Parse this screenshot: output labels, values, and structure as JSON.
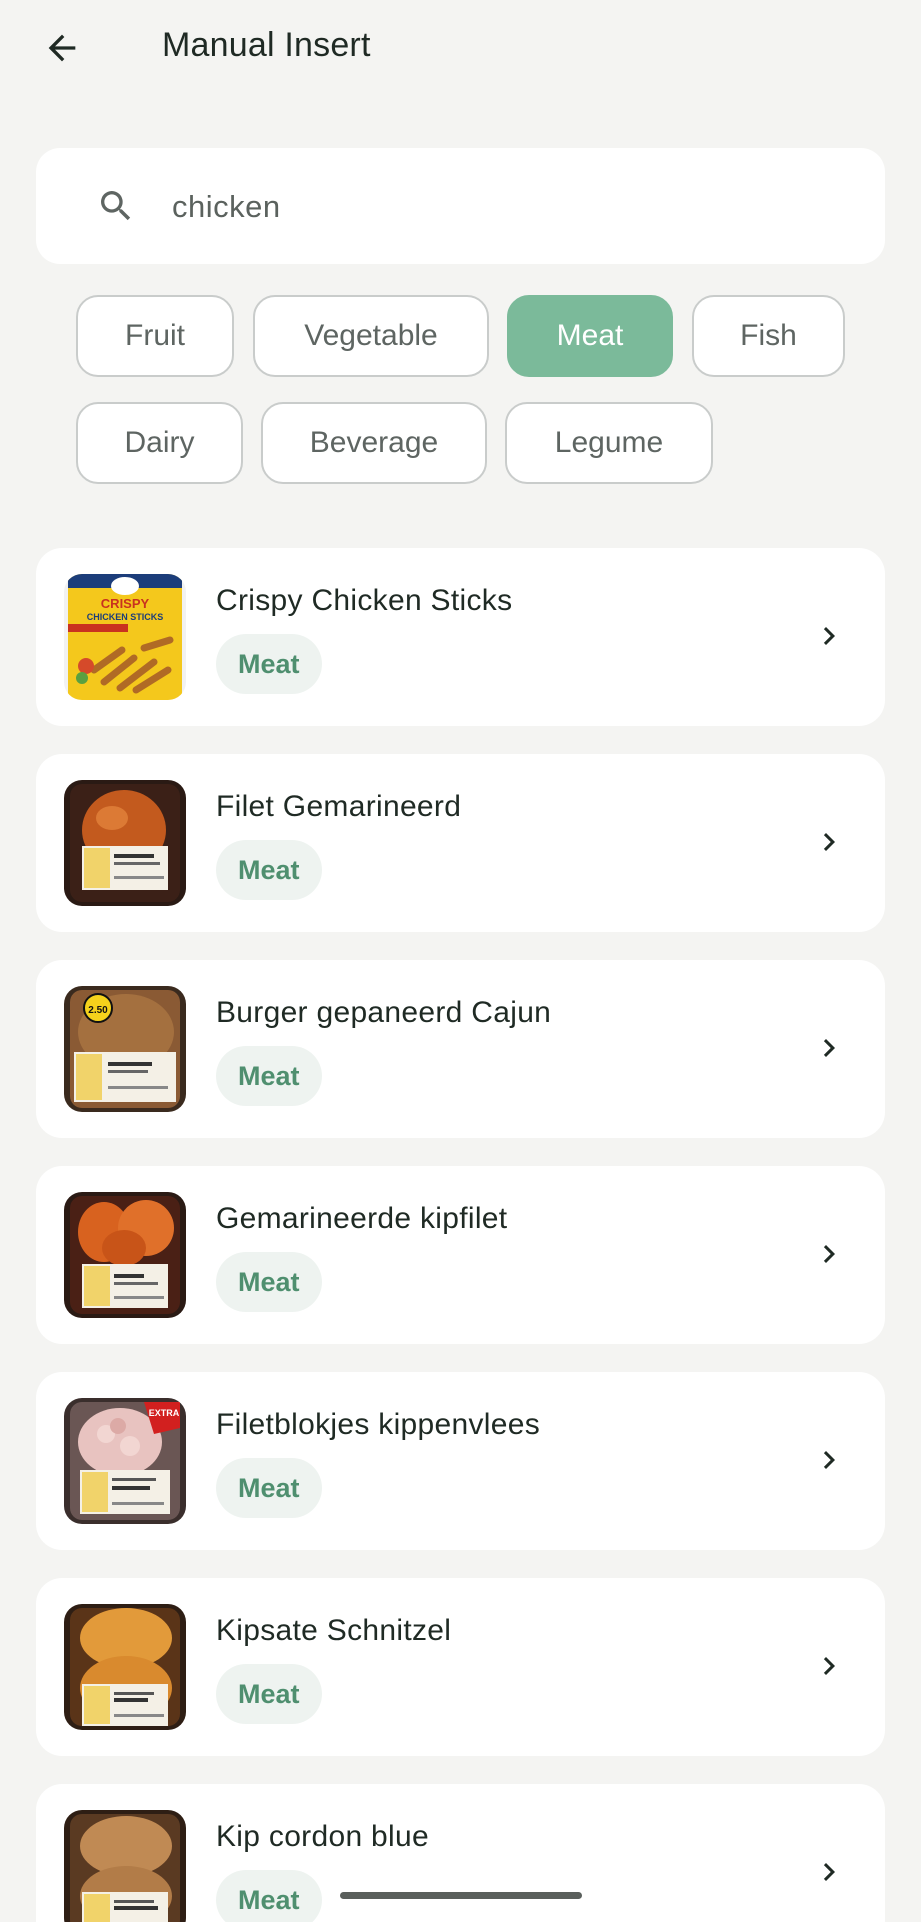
{
  "header": {
    "title": "Manual Insert"
  },
  "search": {
    "value": "chicken"
  },
  "categories": [
    {
      "label": "Fruit",
      "selected": false
    },
    {
      "label": "Vegetable",
      "selected": false
    },
    {
      "label": "Meat",
      "selected": true
    },
    {
      "label": "Fish",
      "selected": false
    },
    {
      "label": "Dairy",
      "selected": false
    },
    {
      "label": "Beverage",
      "selected": false
    },
    {
      "label": "Legume",
      "selected": false
    }
  ],
  "items": [
    {
      "title": "Crispy Chicken Sticks",
      "tag": "Meat"
    },
    {
      "title": "Filet Gemarineerd",
      "tag": "Meat"
    },
    {
      "title": "Burger gepaneerd Cajun",
      "tag": "Meat"
    },
    {
      "title": "Gemarineerde kipfilet",
      "tag": "Meat"
    },
    {
      "title": "Filetblokjes kippenvlees",
      "tag": "Meat"
    },
    {
      "title": "Kipsate Schnitzel",
      "tag": "Meat"
    },
    {
      "title": "Kip cordon blue",
      "tag": "Meat"
    }
  ],
  "thumb_labels": {
    "crispy_line1": "CRISPY",
    "crispy_line2": "CHICKEN STICKS",
    "price_badge": "2.50",
    "extra_badge": "EXTRA"
  },
  "colors": {
    "accent": "#7bba9a",
    "tag_text": "#4f8f6f",
    "tag_bg": "#eef3f0",
    "background": "#f4f4f2"
  }
}
